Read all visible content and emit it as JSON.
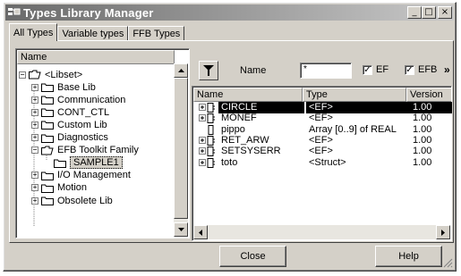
{
  "window": {
    "title": "Types Library Manager"
  },
  "title_buttons": {
    "minimize": "_",
    "maximize": "□",
    "close": "×"
  },
  "tabs": [
    {
      "label": "All Types",
      "active": true
    },
    {
      "label": "Variable types",
      "active": false
    },
    {
      "label": "FFB Types",
      "active": false
    }
  ],
  "tree": {
    "header": "Name",
    "items": [
      {
        "label": "<Libset>",
        "expander": "−",
        "icon": "open-folder-icon"
      },
      {
        "label": "Base Lib",
        "expander": "+",
        "icon": "folder-icon"
      },
      {
        "label": "Communication",
        "expander": "+",
        "icon": "folder-icon"
      },
      {
        "label": "CONT_CTL",
        "expander": "+",
        "icon": "folder-icon"
      },
      {
        "label": "Custom Lib",
        "expander": "+",
        "icon": "folder-icon"
      },
      {
        "label": "Diagnostics",
        "expander": "+",
        "icon": "folder-icon"
      },
      {
        "label": "EFB Toolkit Family",
        "expander": "−",
        "icon": "open-folder-icon"
      },
      {
        "label": "SAMPLE1",
        "expander": "",
        "icon": "folder-icon",
        "selected": true
      },
      {
        "label": "I/O Management",
        "expander": "+",
        "icon": "folder-icon"
      },
      {
        "label": "Motion",
        "expander": "+",
        "icon": "folder-icon"
      },
      {
        "label": "Obsolete Lib",
        "expander": "+",
        "icon": "folder-icon"
      }
    ]
  },
  "toolbar": {
    "filter_icon": "funnel-icon",
    "name_label": "Name",
    "name_value": "*",
    "ef_label": "EF",
    "ef_checked": "✓",
    "efb_label": "EFB",
    "efb_checked": "✓",
    "more": "»"
  },
  "list": {
    "columns": [
      "Name",
      "Type",
      "Version"
    ],
    "rows": [
      {
        "expander": "+",
        "name": "CIRCLE",
        "type": "<EF>",
        "version": "1.00",
        "selected": true
      },
      {
        "expander": "+",
        "name": "MONEF",
        "type": "<EF>",
        "version": "1.00"
      },
      {
        "expander": "",
        "name": "pippo",
        "type": "Array [0..9] of REAL",
        "version": "1.00"
      },
      {
        "expander": "+",
        "name": "RET_ARW",
        "type": "<EF>",
        "version": "1.00"
      },
      {
        "expander": "+",
        "name": "SETSYSERR",
        "type": "<EF>",
        "version": "1.00"
      },
      {
        "expander": "+",
        "name": "toto",
        "type": "<Struct>",
        "version": "1.00"
      }
    ]
  },
  "buttons": {
    "close": "Close",
    "help": "Help"
  },
  "colors": {
    "face": "#d4d0c8",
    "selection": "#000000",
    "title_start": "#6a6a6a"
  }
}
